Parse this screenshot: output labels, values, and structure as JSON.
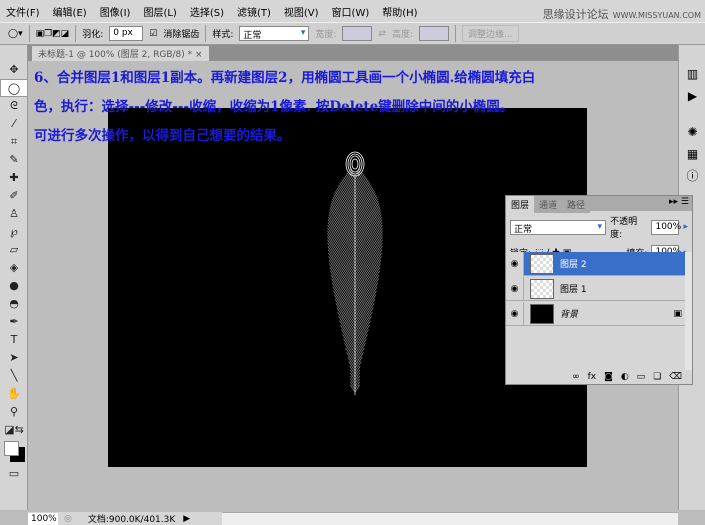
{
  "menu": [
    "文件(F)",
    "编辑(E)",
    "图像(I)",
    "图层(L)",
    "选择(S)",
    "滤镜(T)",
    "视图(V)",
    "窗口(W)",
    "帮助(H)"
  ],
  "watermark": {
    "cn": "思缘设计论坛",
    "url": "WWW.MISSYUAN.COM"
  },
  "options": {
    "feather_label": "羽化:",
    "feather_value": "0 px",
    "antialias_label": "消除锯齿",
    "style_label": "样式:",
    "style_value": "正常",
    "width_label": "宽度:",
    "height_label": "高度:",
    "refine_label": "调整边缘..."
  },
  "doc_tab": "未标题-1 @ 100% (图层 2, RGB/8) *",
  "doc_tab_close": "×",
  "instruction": [
    "6、合并图层1和图层1副本。再新建图层2，用椭圆工具画一个小椭圆.给椭圆填充白",
    "色，执行：选择---修改---收缩，收缩为1像素. 按Delete键删除中间的小椭圆。",
    "可进行多次操作，以得到自己想要的结果。"
  ],
  "layers_panel": {
    "tabs": [
      "图层",
      "通道",
      "路径"
    ],
    "blend_mode": "正常",
    "opacity_label": "不透明度:",
    "opacity": "100%",
    "lock_label": "锁定:",
    "fill_label": "填充:",
    "fill": "100%",
    "layers": [
      {
        "name": "图层 2",
        "selected": true
      },
      {
        "name": "图层 1",
        "selected": false
      },
      {
        "name": "背景",
        "selected": false,
        "locked": true
      }
    ],
    "footer_icons": [
      "link-icon",
      "fx-icon",
      "mask-icon",
      "adjustment-icon",
      "group-icon",
      "new-layer-icon",
      "trash-icon"
    ]
  },
  "status": {
    "zoom": "100%",
    "doc_size": "文档:900.0K/401.3K"
  },
  "colors": {
    "instruction_text": "#1a1adb",
    "selected_layer": "#3a6fc9"
  }
}
